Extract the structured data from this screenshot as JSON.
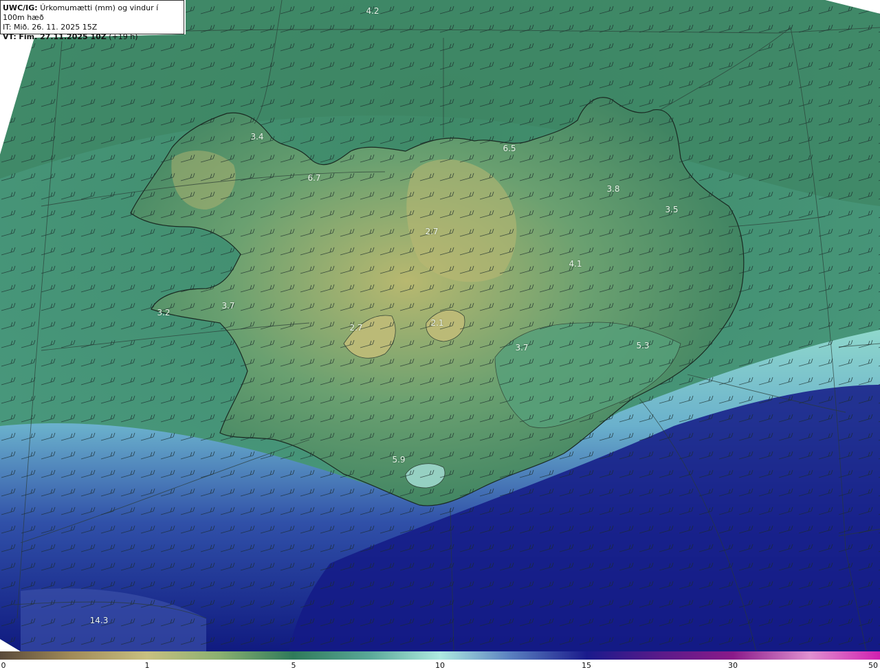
{
  "header": {
    "product": "UWC/IG:",
    "description": "Úrkomumætti (mm) og vindur í 100m hæð",
    "issue_time": "IT: Mið. 26. 11. 2025 15Z",
    "valid_prefix": "VT:",
    "valid_time": "Fim. 27.11.2025 10Z",
    "lead_time": "(+19 h)"
  },
  "map": {
    "variable": "precipitable water (mm)",
    "wind_barbs": true,
    "value_labels": [
      {
        "id": "label-4-2",
        "text": "4.2"
      },
      {
        "id": "label-3-4",
        "text": "3.4"
      },
      {
        "id": "label-6-7",
        "text": "6.7"
      },
      {
        "id": "label-6-5",
        "text": "6.5"
      },
      {
        "id": "label-3-8",
        "text": "3.8"
      },
      {
        "id": "label-3-5",
        "text": "3.5"
      },
      {
        "id": "label-2-7-north",
        "text": "2.7"
      },
      {
        "id": "label-4-1",
        "text": "4.1"
      },
      {
        "id": "label-3-2",
        "text": "3.2"
      },
      {
        "id": "label-3-7-west",
        "text": "3.7"
      },
      {
        "id": "label-2-7-centre",
        "text": "2.7"
      },
      {
        "id": "label-2-1",
        "text": "2.1"
      },
      {
        "id": "label-3-7-east",
        "text": "3.7"
      },
      {
        "id": "label-5-3",
        "text": "5.3"
      },
      {
        "id": "label-5-9",
        "text": "5.9"
      },
      {
        "id": "label-14-3",
        "text": "14.3"
      }
    ]
  },
  "colorbar": {
    "ticks": [
      "0",
      "1",
      "5",
      "10",
      "15",
      "30",
      "50"
    ],
    "colors": [
      "#5a4a3a",
      "#c8c080",
      "#2f7a5a",
      "#aeeae0",
      "#1a1a8c",
      "#8a1a8a",
      "#d020b0"
    ]
  }
}
